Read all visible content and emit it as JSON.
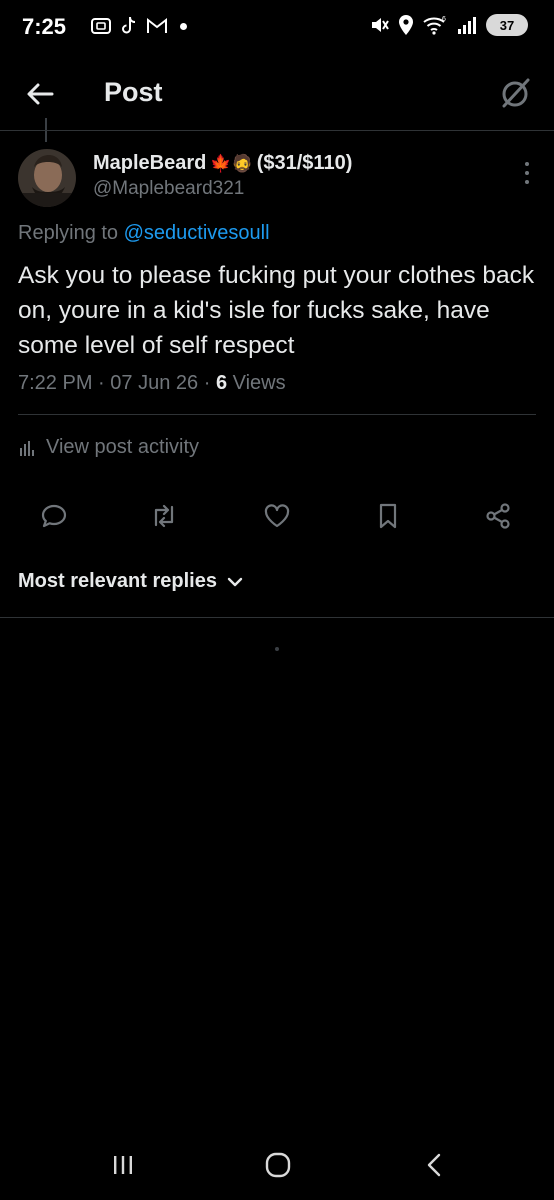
{
  "status_bar": {
    "time": "7:25",
    "battery": "37",
    "network_badge": "6",
    "icons": [
      "screenshot-icon",
      "tiktok-icon",
      "gmail-icon",
      "notification-dot",
      "mute-icon",
      "location-icon",
      "wifi-icon",
      "signal-icon",
      "battery-icon"
    ]
  },
  "header": {
    "title": "Post",
    "back_icon": "arrow-left-icon",
    "grok_icon": "grok-icon"
  },
  "post": {
    "author_name": "MapleBeard",
    "author_emojis": "🍁🧔",
    "author_suffix": "($31/$110)",
    "handle": "@Maplebeard321",
    "replying_prefix": "Replying to",
    "replying_to": "@seductivesoull",
    "text": "Ask you to please fucking put your clothes back on, youre in a kid's isle for fucks sake, have some level of self respect",
    "time": "7:22 PM",
    "date": "07 Jun 26",
    "views_count": "6",
    "views_label": "Views",
    "separator": "·"
  },
  "activity": {
    "label": "View post activity",
    "icon": "bar-chart-icon"
  },
  "actions": [
    {
      "name": "reply-button",
      "icon": "reply-icon"
    },
    {
      "name": "repost-button",
      "icon": "repost-icon"
    },
    {
      "name": "like-button",
      "icon": "heart-icon"
    },
    {
      "name": "bookmark-button",
      "icon": "bookmark-icon"
    },
    {
      "name": "share-button",
      "icon": "share-icon"
    }
  ],
  "replies_sort": {
    "label": "Most relevant replies",
    "icon": "chevron-down-icon"
  },
  "nav": {
    "icons": [
      "recents-icon",
      "home-icon",
      "back-icon"
    ]
  },
  "colors": {
    "background": "#000000",
    "text": "#e7e9ea",
    "muted": "#71767b",
    "accent": "#1d9bf0",
    "divider": "#2f3336"
  }
}
